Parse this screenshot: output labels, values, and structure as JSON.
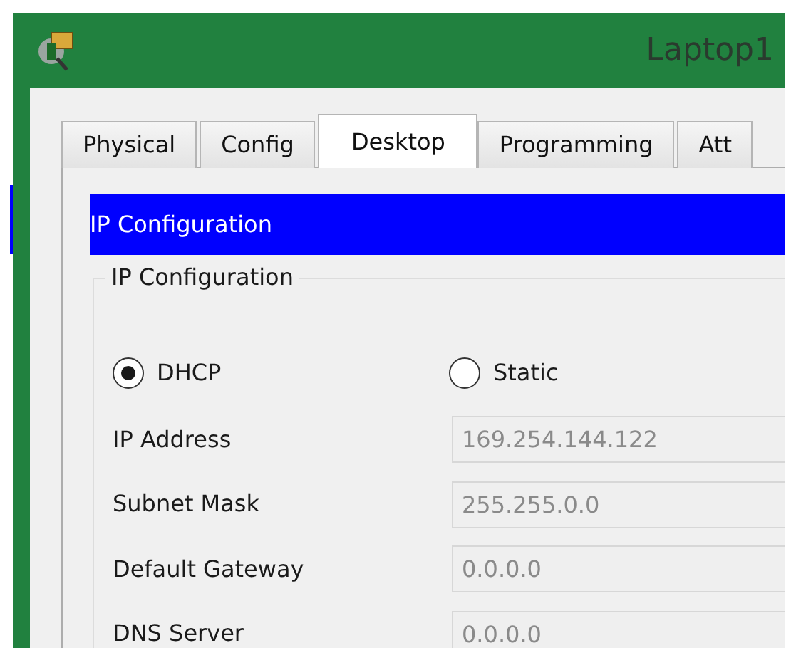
{
  "window": {
    "title": "Laptop1"
  },
  "tabs": [
    {
      "label": "Physical",
      "selected": false
    },
    {
      "label": "Config",
      "selected": false
    },
    {
      "label": "Desktop",
      "selected": true
    },
    {
      "label": "Programming",
      "selected": false
    },
    {
      "label": "Att",
      "selected": false
    }
  ],
  "header": {
    "title": "IP Configuration"
  },
  "group": {
    "legend": "IP Configuration",
    "modes": [
      {
        "label": "DHCP",
        "selected": true
      },
      {
        "label": "Static",
        "selected": false
      }
    ],
    "fields": [
      {
        "label": "IP Address",
        "value": "169.254.144.122",
        "disabled": true
      },
      {
        "label": "Subnet Mask",
        "value": "255.255.0.0",
        "disabled": true
      },
      {
        "label": "Default Gateway",
        "value": "0.0.0.0",
        "disabled": true
      },
      {
        "label": "DNS Server",
        "value": "0.0.0.0",
        "disabled": true
      }
    ]
  }
}
